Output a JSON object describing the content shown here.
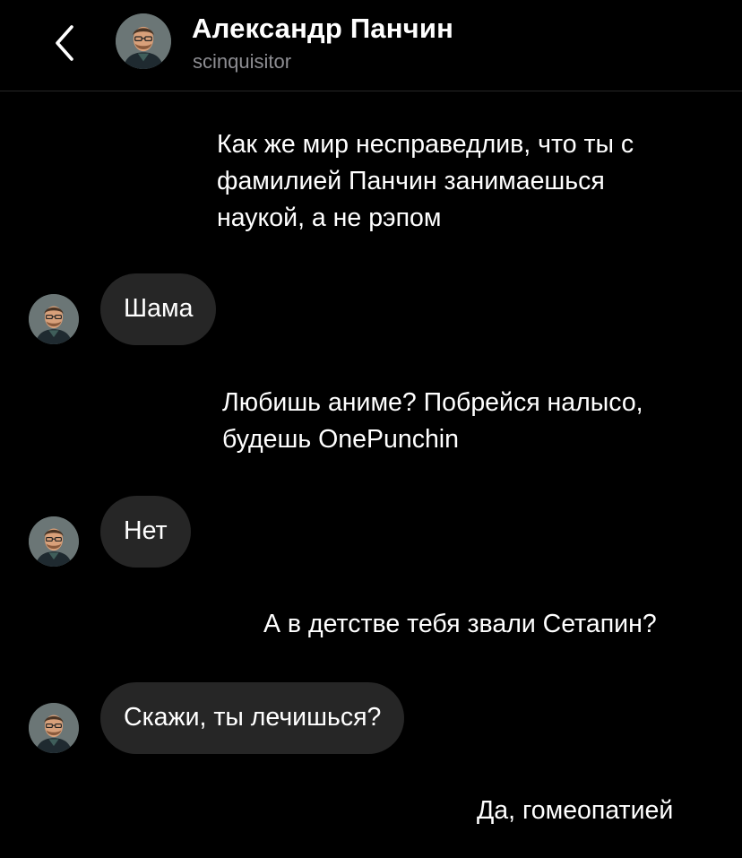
{
  "header": {
    "back_icon": "chevron-left-icon",
    "contact_name": "Александр Панчин",
    "contact_handle": "scinquisitor",
    "avatar_icon": "avatar-photo"
  },
  "messages": [
    {
      "direction": "outgoing",
      "lines": [
        "Как же мир несправедлив, что ты с",
        "фамилией Панчин занимаешься",
        "наукой, а не рэпом"
      ]
    },
    {
      "direction": "incoming",
      "lines": [
        "Шама"
      ]
    },
    {
      "direction": "outgoing",
      "lines": [
        "Любишь аниме? Побрейся налысо,",
        "будешь OnePunchin"
      ]
    },
    {
      "direction": "incoming",
      "lines": [
        "Нет"
      ]
    },
    {
      "direction": "outgoing",
      "lines": [
        "А в детстве тебя звали Сетапин?"
      ]
    },
    {
      "direction": "incoming",
      "lines": [
        "Скажи, ты лечишься?"
      ]
    },
    {
      "direction": "outgoing",
      "lines": [
        "Да, гомеопатией"
      ]
    }
  ],
  "colors": {
    "background": "#000000",
    "incoming_bubble": "#262626",
    "outgoing_gradient_top": "#8a3ee6",
    "outgoing_gradient_bottom": "#5b4be8",
    "secondary_text": "#8e8e93"
  }
}
